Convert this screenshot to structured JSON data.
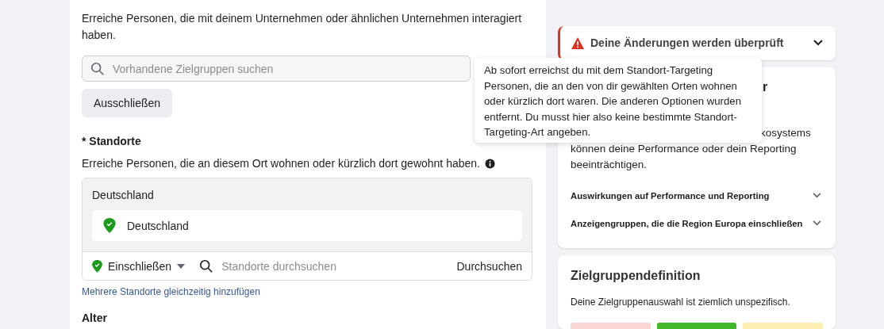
{
  "audience": {
    "description": "Erreiche Personen, die mit deinem Unternehmen oder ähnlichen Unternehmen interagiert haben.",
    "search": {
      "placeholder": "Vorhandene Zielgruppen suchen"
    },
    "exclude_button": "Ausschließen"
  },
  "locations": {
    "title": "* Standorte",
    "description": "Erreiche Personen, die an diesem Ort wohnen oder kürzlich dort gewohnt haben.",
    "group_label": "Deutschland",
    "items": [
      {
        "name": "Deutschland"
      }
    ],
    "mode": "Einschließen",
    "search": {
      "placeholder": "Standorte durchsuchen"
    },
    "search_button": "Durchsuchen",
    "bulk_link": "Mehrere Standorte gleichzeitig hinzufügen"
  },
  "age": {
    "title": "Alter"
  },
  "tooltip": "Ab sofort erreichst du mit dem Standort-Targeting Personen, die an den von dir gewählten Orten wohnen oder kürzlich dort waren. Die anderen Optionen wurden entfernt. Du musst hier also keine bestimmte Standort-Targeting-Art angeben.",
  "review_banner": {
    "title": "Deine Änderungen werden überprüft",
    "expanded": false
  },
  "notice_card": {
    "title_fragment": "r",
    "lines": [
      "kosystems",
      "können deine Performance oder dein Reporting",
      "beeinträchtigen."
    ],
    "sections": [
      {
        "title": "Auswirkungen auf Performance und Reporting",
        "expanded": false
      },
      {
        "title": "Anzeigengruppen, die die Region Europa einschließen",
        "expanded": false
      }
    ]
  },
  "definition_card": {
    "title": "Zielgruppendefinition",
    "text": "Deine Zielgruppenauswahl ist ziemlich unspezifisch."
  }
}
